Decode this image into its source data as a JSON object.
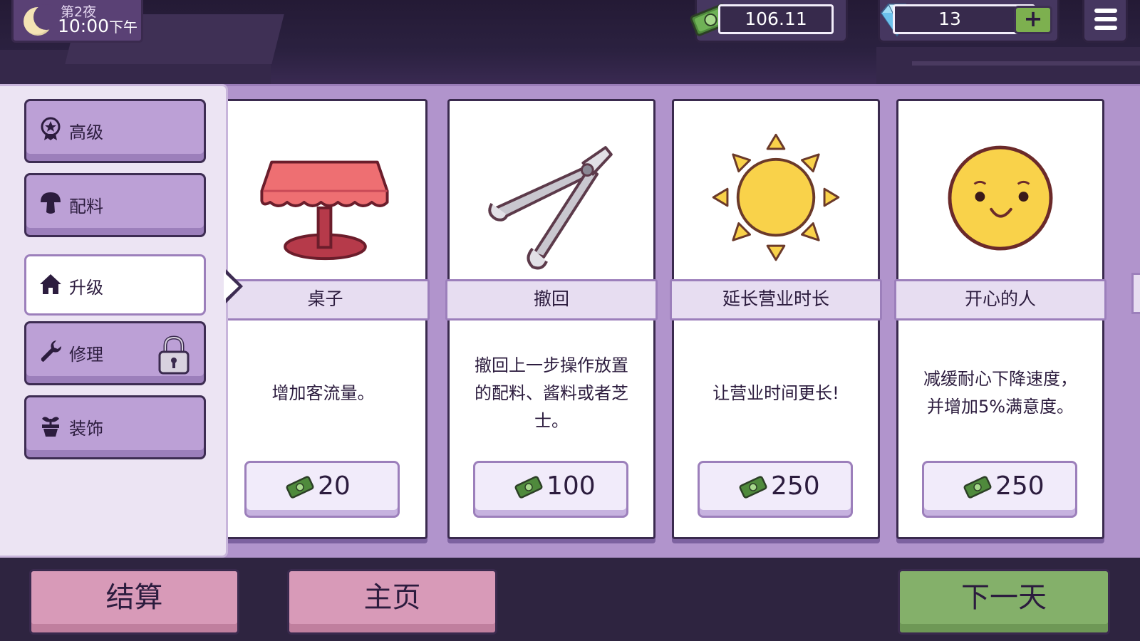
{
  "hud": {
    "night_label": "第2夜",
    "time": "10:00",
    "time_suffix": "下午",
    "cash": "106.11",
    "gems": "13",
    "plus_label": "+"
  },
  "sidebar": {
    "items": [
      {
        "label": "高级",
        "icon": "badge-star-icon",
        "active": false,
        "locked": false
      },
      {
        "label": "配料",
        "icon": "mushroom-icon",
        "active": false,
        "locked": false
      },
      {
        "label": "升级",
        "icon": "home-icon",
        "active": true,
        "locked": false
      },
      {
        "label": "修理",
        "icon": "wrench-icon",
        "active": false,
        "locked": true
      },
      {
        "label": "装饰",
        "icon": "potted-plant-icon",
        "active": false,
        "locked": false
      }
    ]
  },
  "cards": [
    {
      "title": "桌子",
      "desc": "增加客流量。",
      "price": "20",
      "icon": "table-icon"
    },
    {
      "title": "撤回",
      "desc": "撤回上一步操作放置的配料、酱料或者芝士。",
      "price": "100",
      "icon": "tongs-icon"
    },
    {
      "title": "延长营业时长",
      "desc": "让营业时间更长!",
      "price": "250",
      "icon": "sun-icon"
    },
    {
      "title": "开心的人",
      "desc": "减缓耐心下降速度，并增加5%满意度。",
      "price": "250",
      "icon": "smiley-icon"
    }
  ],
  "bottom": {
    "settle_label": "结算",
    "home_label": "主页",
    "next_day_label": "下一天"
  },
  "colors": {
    "panel_purple": "#bca0d6",
    "card_area": "#b194cc",
    "next_green": "#84b06a",
    "pink_button": "#d89ab8",
    "outline": "#3a2a4e"
  }
}
